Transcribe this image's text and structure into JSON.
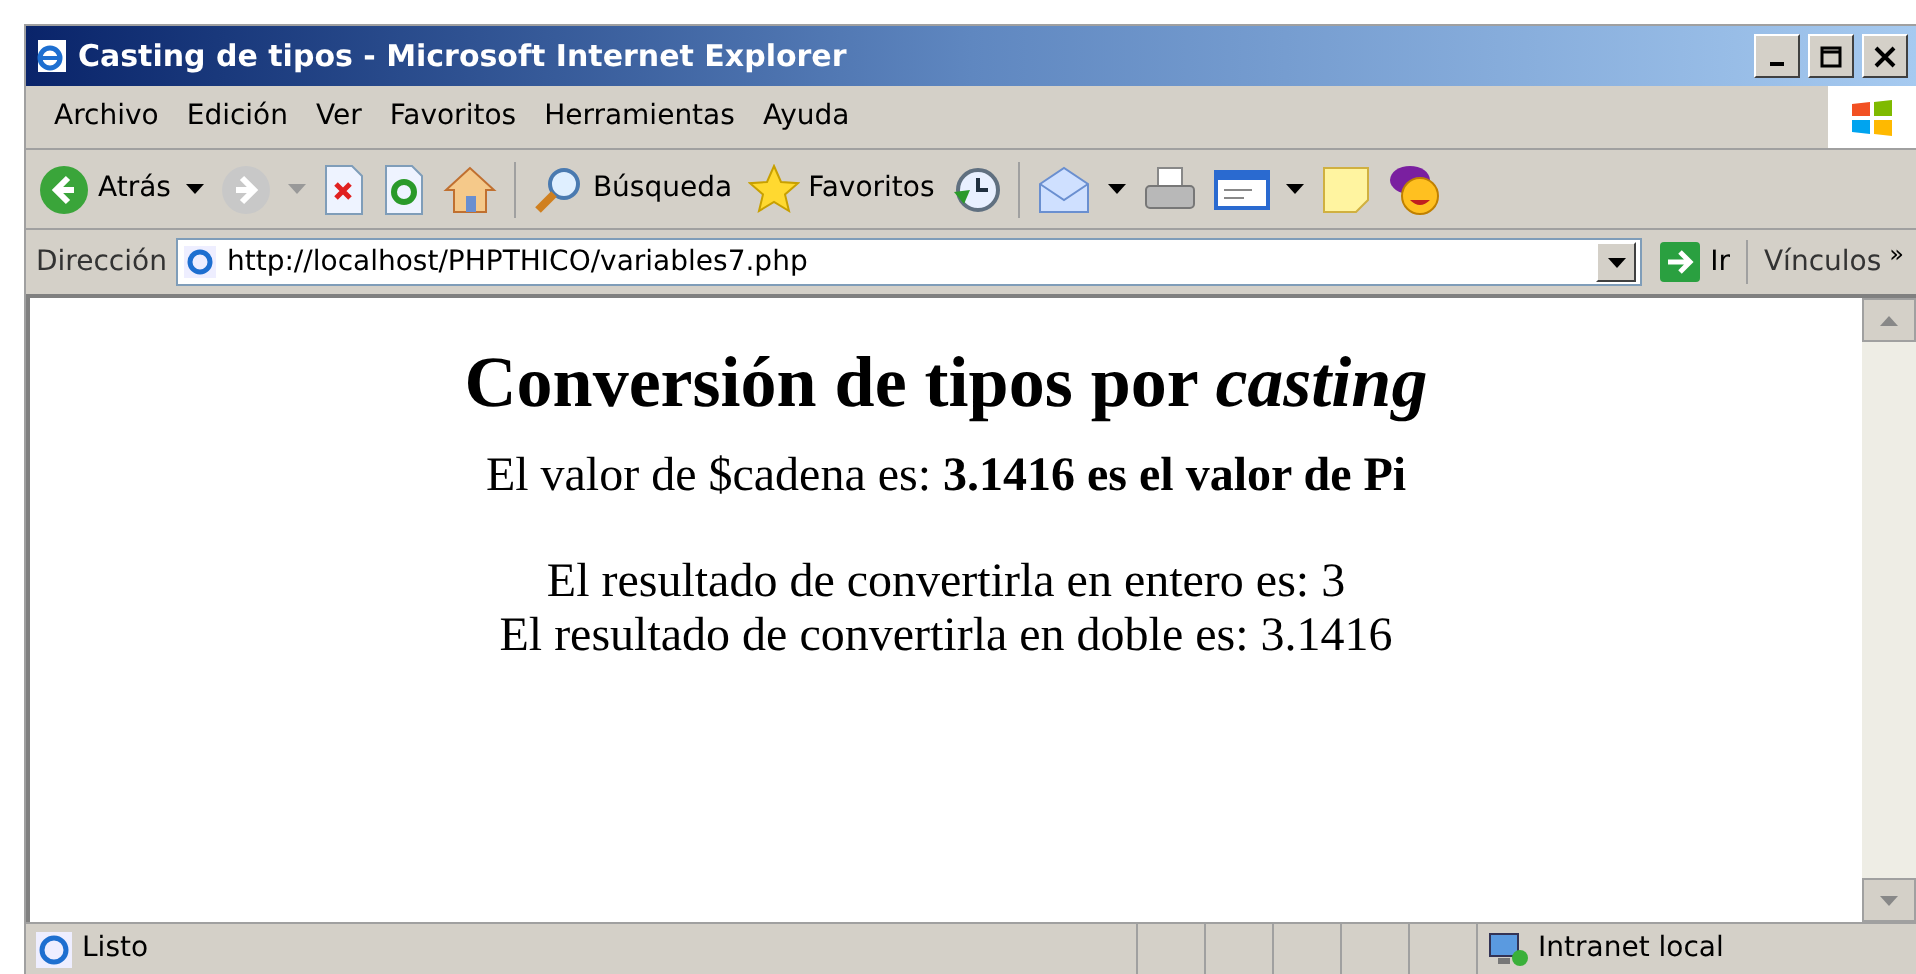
{
  "window": {
    "title": "Casting de tipos - Microsoft Internet Explorer"
  },
  "menu": [
    "Archivo",
    "Edición",
    "Ver",
    "Favoritos",
    "Herramientas",
    "Ayuda"
  ],
  "toolbar": {
    "back_label": "Atrás",
    "search_label": "Búsqueda",
    "favorites_label": "Favoritos"
  },
  "address_bar": {
    "label": "Dirección",
    "value": "http://localhost/PHPTHICO/variables7.php",
    "go_label": "Ir",
    "links_label": "Vínculos",
    "links_more": "»"
  },
  "page": {
    "heading": "Conversión de tipos por *casting*",
    "lines": [
      "El valor de $cadena es: **3.1416 es el valor de Pi**",
      "El resultado de convertirla en entero es: 3",
      "El resultado de convertirla en doble es: 3.1416"
    ]
  },
  "status_bar": {
    "text": "Listo",
    "zone": "Intranet local"
  }
}
